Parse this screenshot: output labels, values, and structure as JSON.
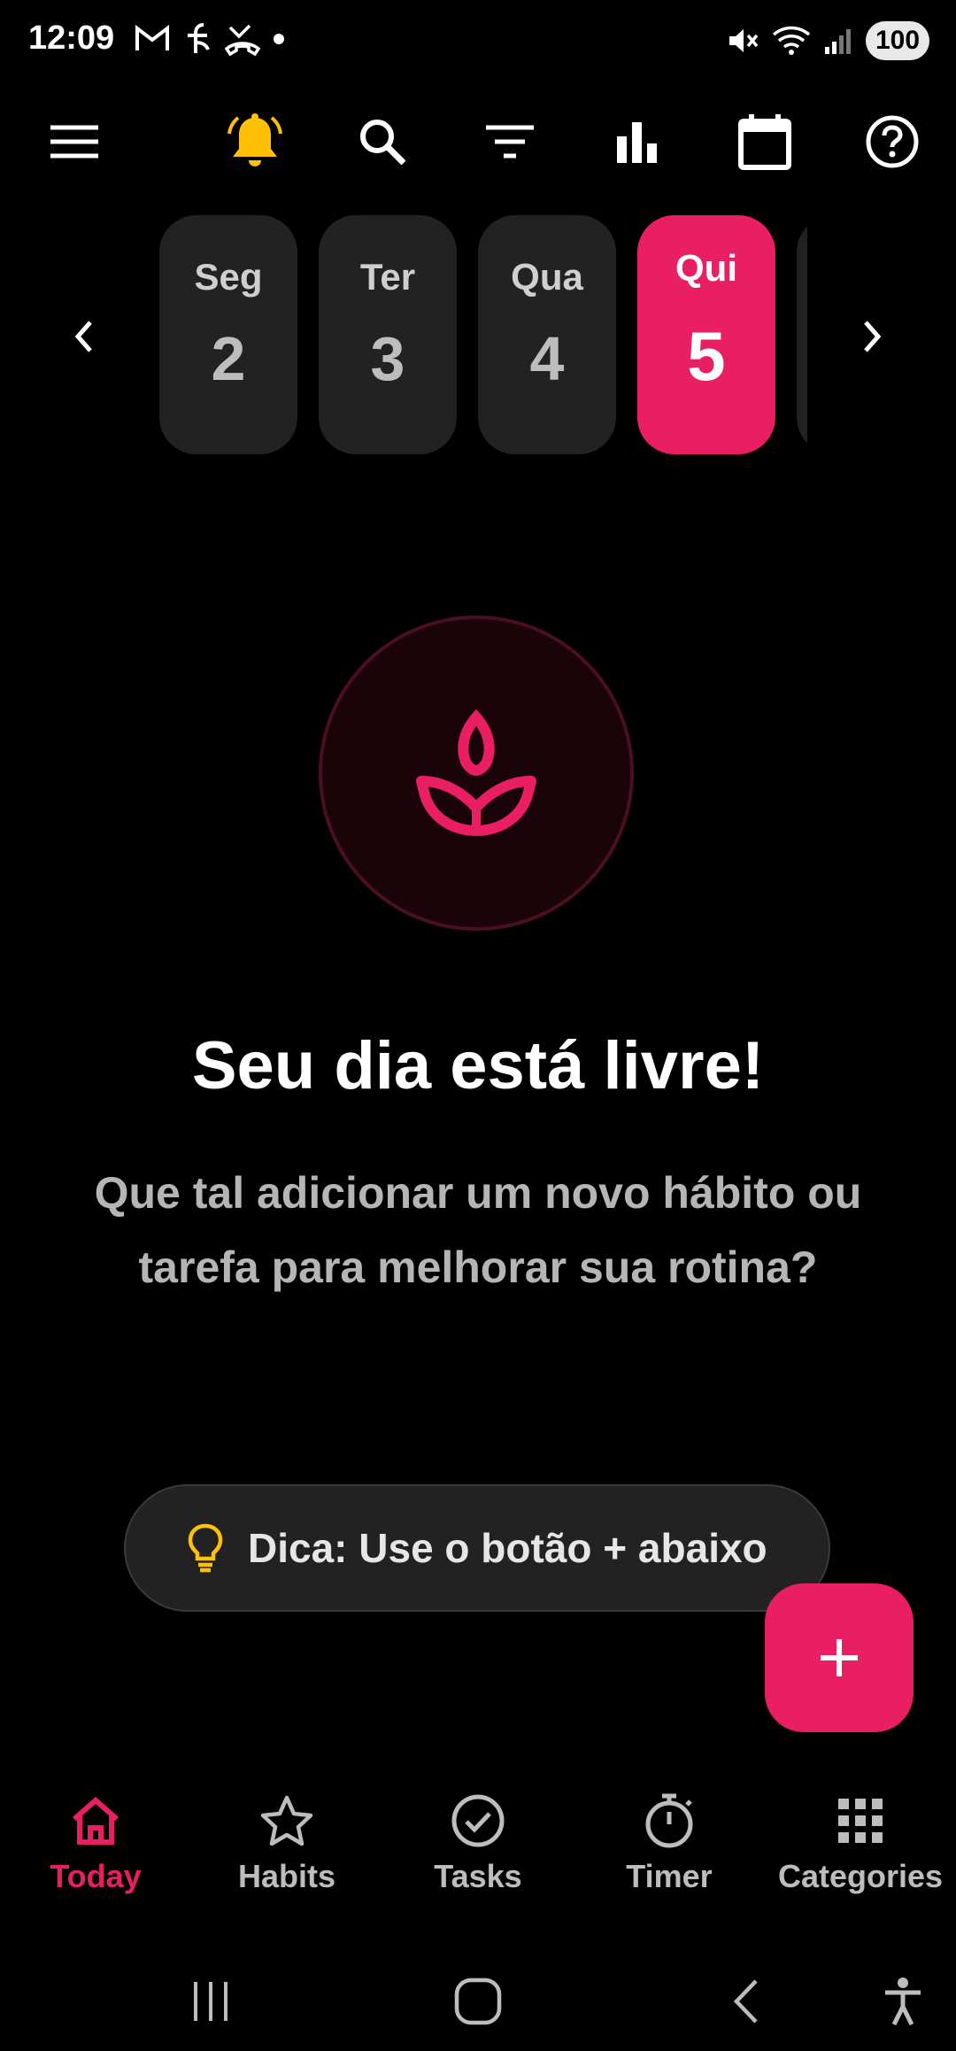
{
  "status_bar": {
    "time": "12:09",
    "left_icons": [
      "gmail-icon",
      "finance-icon",
      "missed-call-icon",
      "dot-icon"
    ],
    "right_icons": [
      "mute-icon",
      "wifi-icon",
      "signal-icon"
    ],
    "battery": "100"
  },
  "toolbar": {
    "icons": [
      "menu-icon",
      "bell-icon",
      "search-icon",
      "filter-icon",
      "bar-chart-icon",
      "calendar-icon",
      "help-icon"
    ],
    "bell_color": "#FFC107"
  },
  "days": [
    {
      "name": "Seg",
      "number": "2",
      "active": false
    },
    {
      "name": "Ter",
      "number": "3",
      "active": false
    },
    {
      "name": "Qua",
      "number": "4",
      "active": false
    },
    {
      "name": "Qui",
      "number": "5",
      "active": true
    }
  ],
  "empty_state": {
    "icon": "lotus-icon",
    "title": "Seu dia está livre!",
    "subtitle": "Que tal adicionar um novo hábito ou tarefa para melhorar sua rotina?"
  },
  "tip": {
    "icon": "lightbulb-icon",
    "text": "Dica: Use o botão + abaixo"
  },
  "fab": {
    "icon": "plus-icon"
  },
  "bottom_nav": [
    {
      "label": "Today",
      "icon": "home-icon",
      "active": true
    },
    {
      "label": "Habits",
      "icon": "star-icon",
      "active": false
    },
    {
      "label": "Tasks",
      "icon": "check-circle-icon",
      "active": false
    },
    {
      "label": "Timer",
      "icon": "timer-icon",
      "active": false
    },
    {
      "label": "Categories",
      "icon": "grid-icon",
      "active": false
    }
  ],
  "colors": {
    "accent": "#E91E63",
    "background": "#000000",
    "card": "#222222"
  }
}
